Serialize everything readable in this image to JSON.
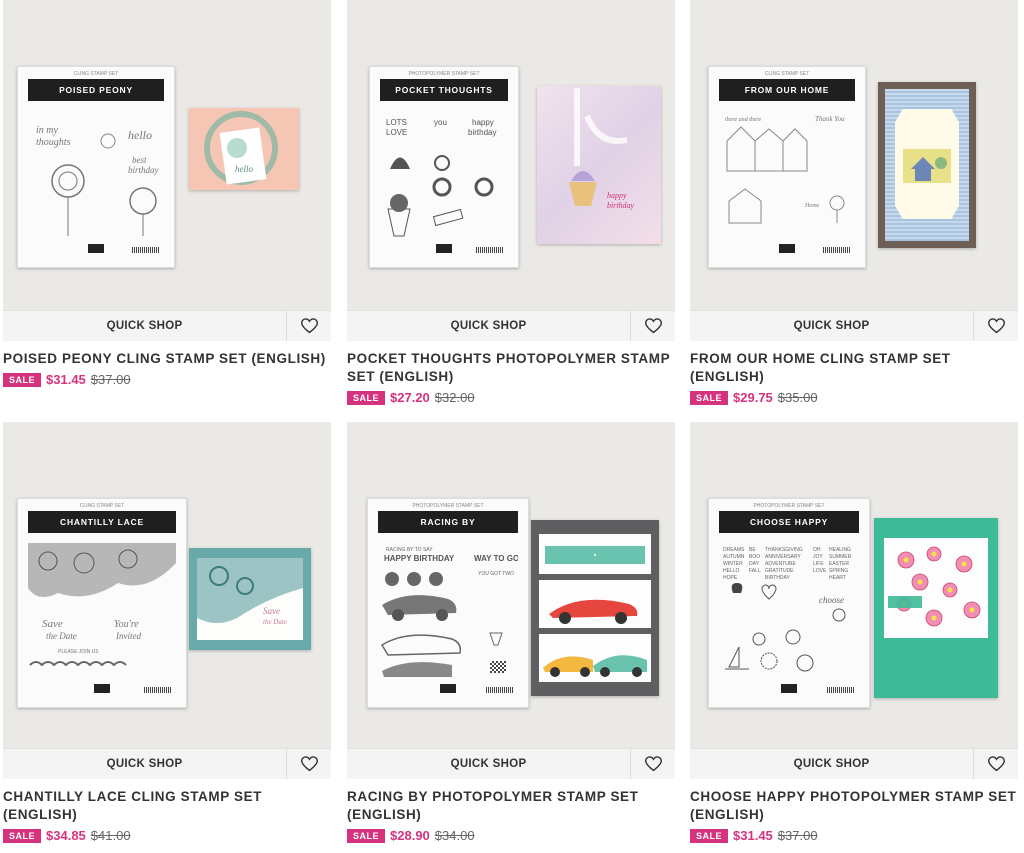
{
  "products": [
    {
      "package_label": "POISED PEONY",
      "package_subtitle": "CLING STAMP SET",
      "quick_shop_label": "QUICK SHOP",
      "title": "POISED PEONY CLING STAMP SET (ENGLISH)",
      "sale_badge": "SALE",
      "sale_price": "$31.45",
      "original_price": "$37.00"
    },
    {
      "package_label": "POCKET THOUGHTS",
      "package_subtitle": "PHOTOPOLYMER STAMP SET",
      "quick_shop_label": "QUICK SHOP",
      "title": "POCKET THOUGHTS PHOTOPOLYMER STAMP SET (ENGLISH)",
      "sale_badge": "SALE",
      "sale_price": "$27.20",
      "original_price": "$32.00"
    },
    {
      "package_label": "FROM OUR HOME",
      "package_subtitle": "CLING STAMP SET",
      "quick_shop_label": "QUICK SHOP",
      "title": "FROM OUR HOME CLING STAMP SET (ENGLISH)",
      "sale_badge": "SALE",
      "sale_price": "$29.75",
      "original_price": "$35.00"
    },
    {
      "package_label": "CHANTILLY LACE",
      "package_subtitle": "CLING STAMP SET",
      "quick_shop_label": "QUICK SHOP",
      "title": "CHANTILLY LACE CLING STAMP SET (ENGLISH)",
      "sale_badge": "SALE",
      "sale_price": "$34.85",
      "original_price": "$41.00"
    },
    {
      "package_label": "RACING BY",
      "package_subtitle": "PHOTOPOLYMER STAMP SET",
      "quick_shop_label": "QUICK SHOP",
      "title": "RACING BY PHOTOPOLYMER STAMP SET (ENGLISH)",
      "sale_badge": "SALE",
      "sale_price": "$28.90",
      "original_price": "$34.00"
    },
    {
      "package_label": "CHOOSE HAPPY",
      "package_subtitle": "PHOTOPOLYMER STAMP SET",
      "quick_shop_label": "QUICK SHOP",
      "title": "CHOOSE HAPPY PHOTOPOLYMER STAMP SET (ENGLISH)",
      "sale_badge": "SALE",
      "sale_price": "$31.45",
      "original_price": "$37.00"
    }
  ],
  "icons": {
    "favorite": "heart-outline-icon"
  },
  "colors": {
    "sale_accent": "#d6337f",
    "image_background": "#eae9e6",
    "quick_shop_bar": "#f4f4f4"
  }
}
